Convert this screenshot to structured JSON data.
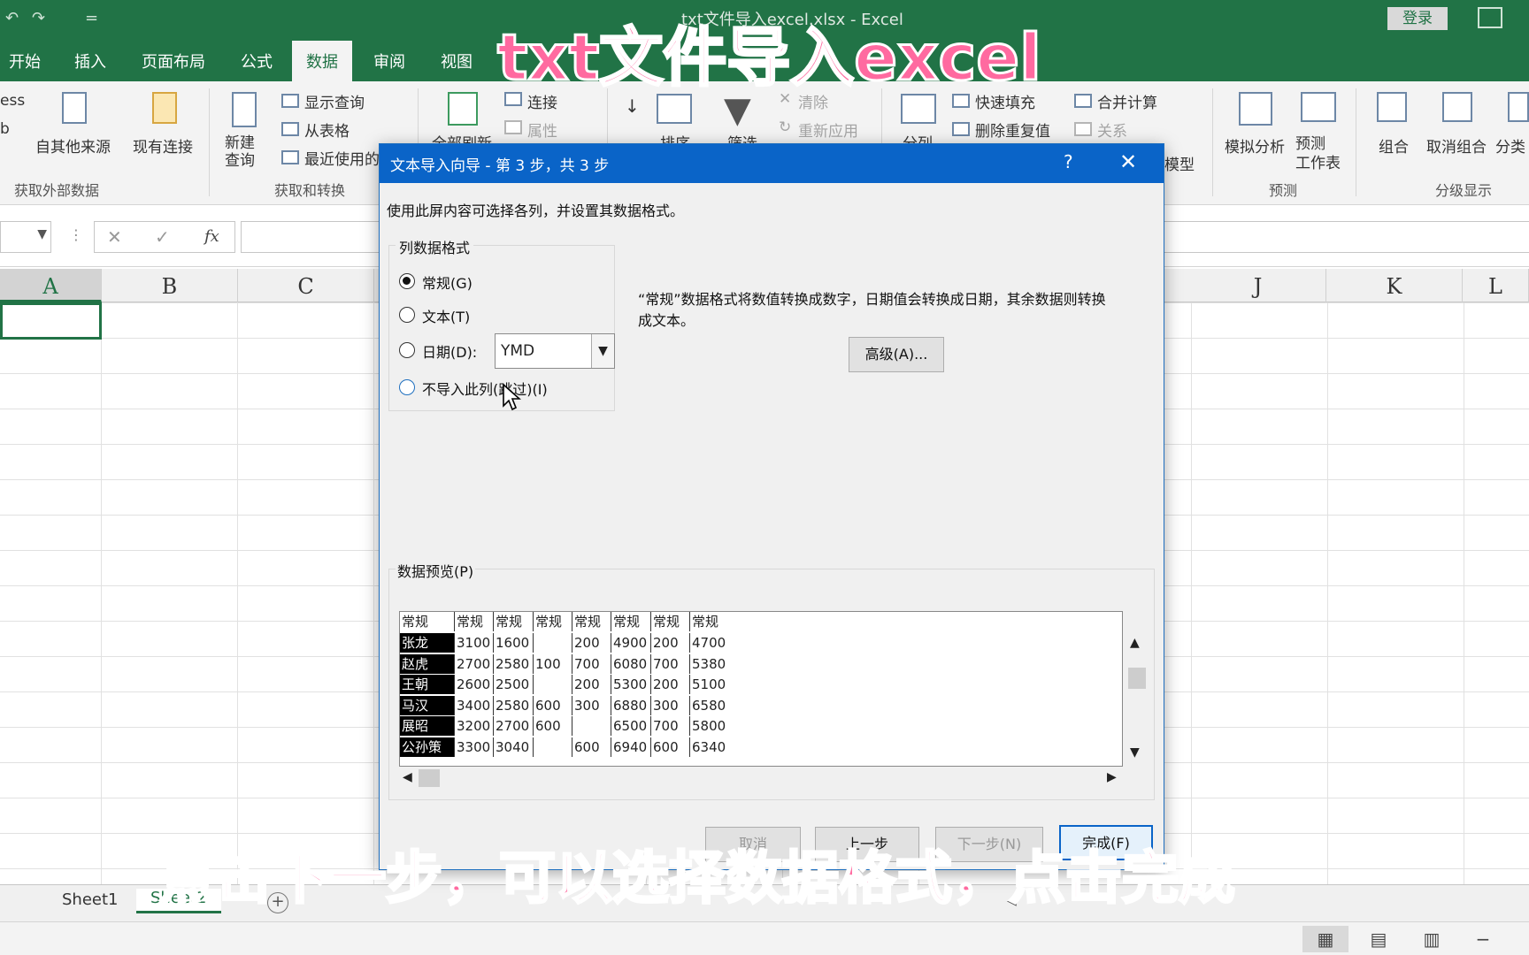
{
  "titlebar": {
    "title": "txt文件导入excel.xlsx  -  Excel",
    "login": "登录",
    "undo_glyph": "↶",
    "redo_glyph": "↷",
    "customize_glyph": "="
  },
  "tabs": [
    "开始",
    "插入",
    "页面布局",
    "公式",
    "数据",
    "审阅",
    "视图"
  ],
  "active_tab": "数据",
  "ribbon": {
    "access_partial": "ess",
    "web_partial": "b",
    "from_other_sources": "自其他来源",
    "existing_connections": "现有连接",
    "group_get_external": "获取外部数据",
    "new_query": "新建\n查询",
    "show_query": "显示查询",
    "from_table": "从表格",
    "recent_sources": "最近使用的",
    "group_get_transform": "获取和转换",
    "refresh_all": "全部刷新",
    "connections": "连接",
    "properties": "属性",
    "sort": "排序",
    "filter": "筛选",
    "clear": "清除",
    "reapply": "重新应用",
    "split": "分列",
    "flash_fill": "快速填充",
    "remove_duplicates": "删除重复值",
    "consolidate": "合并计算",
    "relationships": "关系",
    "data_model_partial": "模型",
    "what_if": "模拟分析",
    "forecast_sheet": "预测\n工作表",
    "group_forecast": "预测",
    "group": "组合",
    "ungroup": "取消组合",
    "subtotal_partial": "分类",
    "group_outline": "分级显示"
  },
  "formula_bar": {
    "cancel_glyph": "✕",
    "enter_glyph": "✓",
    "fx": "fx"
  },
  "columns": [
    "A",
    "B",
    "C",
    "J",
    "K",
    "L"
  ],
  "sheets": [
    "Sheet1",
    "Sheet2"
  ],
  "active_sheet": "Sheet2",
  "dialog": {
    "title": "文本导入向导 - 第 3 步，共 3 步",
    "help": "?",
    "close": "✕",
    "instruction": "使用此屏内容可选择各列，并设置其数据格式。",
    "group_label": "列数据格式",
    "options": [
      {
        "label": "常规(G)",
        "checked": true
      },
      {
        "label": "文本(T)",
        "checked": false
      },
      {
        "label": "日期(D):",
        "checked": false
      },
      {
        "label": "不导入此列(跳过)(I)",
        "checked": false
      }
    ],
    "date_format": "YMD",
    "description": "“常规”数据格式将数值转换成数字，日期值会转换成日期，其余数据则转换\n成文本。",
    "advanced_button": "高级(A)...",
    "preview_label": "数据预览(P)",
    "preview_header": [
      "常规",
      "常规",
      "常规",
      "常规",
      "常规",
      "常规",
      "常规",
      "常规"
    ],
    "preview_rows": [
      [
        "张龙",
        "3100",
        "1600",
        "",
        "200",
        "4900",
        "200",
        "4700"
      ],
      [
        "赵虎",
        "2700",
        "2580",
        "100",
        "700",
        "6080",
        "700",
        "5380"
      ],
      [
        "王朝",
        "2600",
        "2500",
        "",
        "200",
        "5300",
        "200",
        "5100"
      ],
      [
        "马汉",
        "3400",
        "2580",
        "600",
        "300",
        "6880",
        "300",
        "6580"
      ],
      [
        "展昭",
        "3200",
        "2700",
        "600",
        "",
        "6500",
        "700",
        "5800"
      ],
      [
        "公孙策",
        "3300",
        "3040",
        "",
        "600",
        "6940",
        "600",
        "6340"
      ]
    ],
    "buttons": {
      "cancel": "取消",
      "back": "上一步",
      "next": "下一步(N)",
      "finish": "完成(F)"
    }
  },
  "captions": {
    "top": "txt文件导入excel",
    "bottom": "点击下一步，可以选择数据格式，点击完成"
  }
}
